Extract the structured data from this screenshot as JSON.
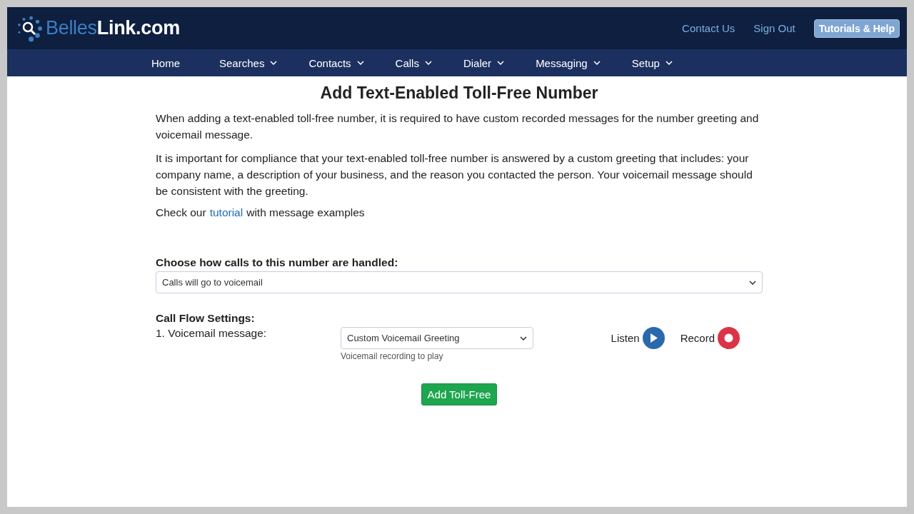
{
  "header": {
    "logo": "Belles**Link.com**",
    "links": [
      "Contact Us",
      "Sign Out"
    ],
    "help_button": "Tutorials & Help"
  },
  "nav": [
    {
      "label": "Home",
      "dropdown": false
    },
    {
      "label": "Searches",
      "dropdown": true
    },
    {
      "label": "Contacts",
      "dropdown": true
    },
    {
      "label": "Calls",
      "dropdown": true
    },
    {
      "label": "Dialer",
      "dropdown": true
    },
    {
      "label": "Messaging",
      "dropdown": true
    },
    {
      "label": "Setup",
      "dropdown": true
    }
  ],
  "page": {
    "title": "Add Text-Enabled Toll-Free Number",
    "paragraphs": [
      "When adding a text-enabled toll-free number, it is required to have custom recorded messages for the number greeting and voicemail message.",
      "It is important for compliance that your text-enabled toll-free number is answered by a custom greeting that includes: your company name, a description of your business, and the reason you contacted the person. Your voicemail message should be consistent with the greeting."
    ],
    "tutorial_line": {
      "before": "Check our",
      "link": "tutorial",
      "after": "with message examples"
    },
    "handling": {
      "label": "Choose how calls to this number are handled:",
      "value": "Calls will go to voicemail"
    },
    "call_flow": {
      "heading": "Call Flow Settings:",
      "label": "1. Voicemail message:",
      "value": "Custom Voicemail Greeting",
      "help": "Voicemail recording to play",
      "listen": "Listen",
      "record": "Record"
    },
    "submit": "Add Toll-Free"
  }
}
